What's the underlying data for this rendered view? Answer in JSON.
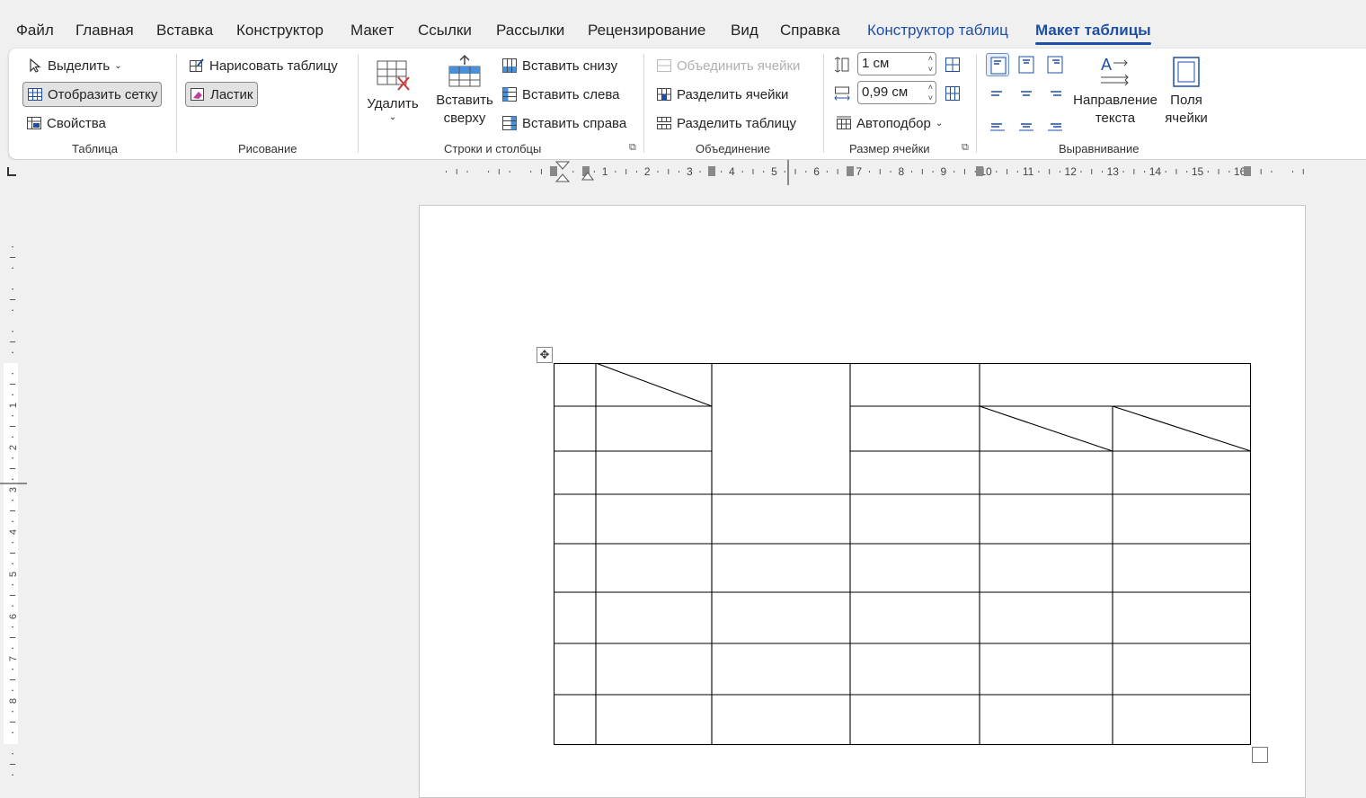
{
  "tabs": [
    {
      "label": "Файл"
    },
    {
      "label": "Главная"
    },
    {
      "label": "Вставка"
    },
    {
      "label": "Конструктор"
    },
    {
      "label": "Макет"
    },
    {
      "label": "Ссылки"
    },
    {
      "label": "Рассылки"
    },
    {
      "label": "Рецензирование"
    },
    {
      "label": "Вид"
    },
    {
      "label": "Справка"
    },
    {
      "label": "Конструктор таблиц"
    },
    {
      "label": "Макет таблицы"
    }
  ],
  "ribbon": {
    "table_group": {
      "select_label": "Выделить",
      "show_grid_label": "Отобразить сетку",
      "properties_label": "Свойства",
      "group_label": "Таблица"
    },
    "draw_group": {
      "draw_table_label": "Нарисовать таблицу",
      "eraser_label": "Ластик",
      "group_label": "Рисование"
    },
    "rows_cols_group": {
      "delete_label": "Удалить",
      "insert_above_label": "Вставить сверху",
      "insert_below_label": "Вставить снизу",
      "insert_left_label": "Вставить слева",
      "insert_right_label": "Вставить справа",
      "group_label": "Строки и столбцы"
    },
    "merge_group": {
      "merge_cells_label": "Объединить ячейки",
      "split_cells_label": "Разделить ячейки",
      "split_table_label": "Разделить таблицу",
      "group_label": "Объединение"
    },
    "cell_size_group": {
      "height_value": "1 см",
      "width_value": "0,99 см",
      "autofit_label": "Автоподбор",
      "group_label": "Размер ячейки"
    },
    "alignment_group": {
      "text_direction_label": "Направление текста",
      "cell_margins_label": "Поля ячейки",
      "group_label": "Выравнивание"
    }
  },
  "ruler": {
    "horizontal_numbers": [
      "1",
      "2",
      "3",
      "4",
      "5",
      "6",
      "7",
      "8",
      "9",
      "10",
      "11",
      "12",
      "13",
      "14",
      "15",
      "16"
    ],
    "vertical_numbers": [
      "1",
      "2",
      "3",
      "4",
      "5",
      "6",
      "7",
      "8"
    ]
  },
  "colors": {
    "accent": "#1e4fa8",
    "grid": "#000000",
    "ribbon_bg": "#ffffff",
    "app_bg": "#f0f0f0"
  }
}
